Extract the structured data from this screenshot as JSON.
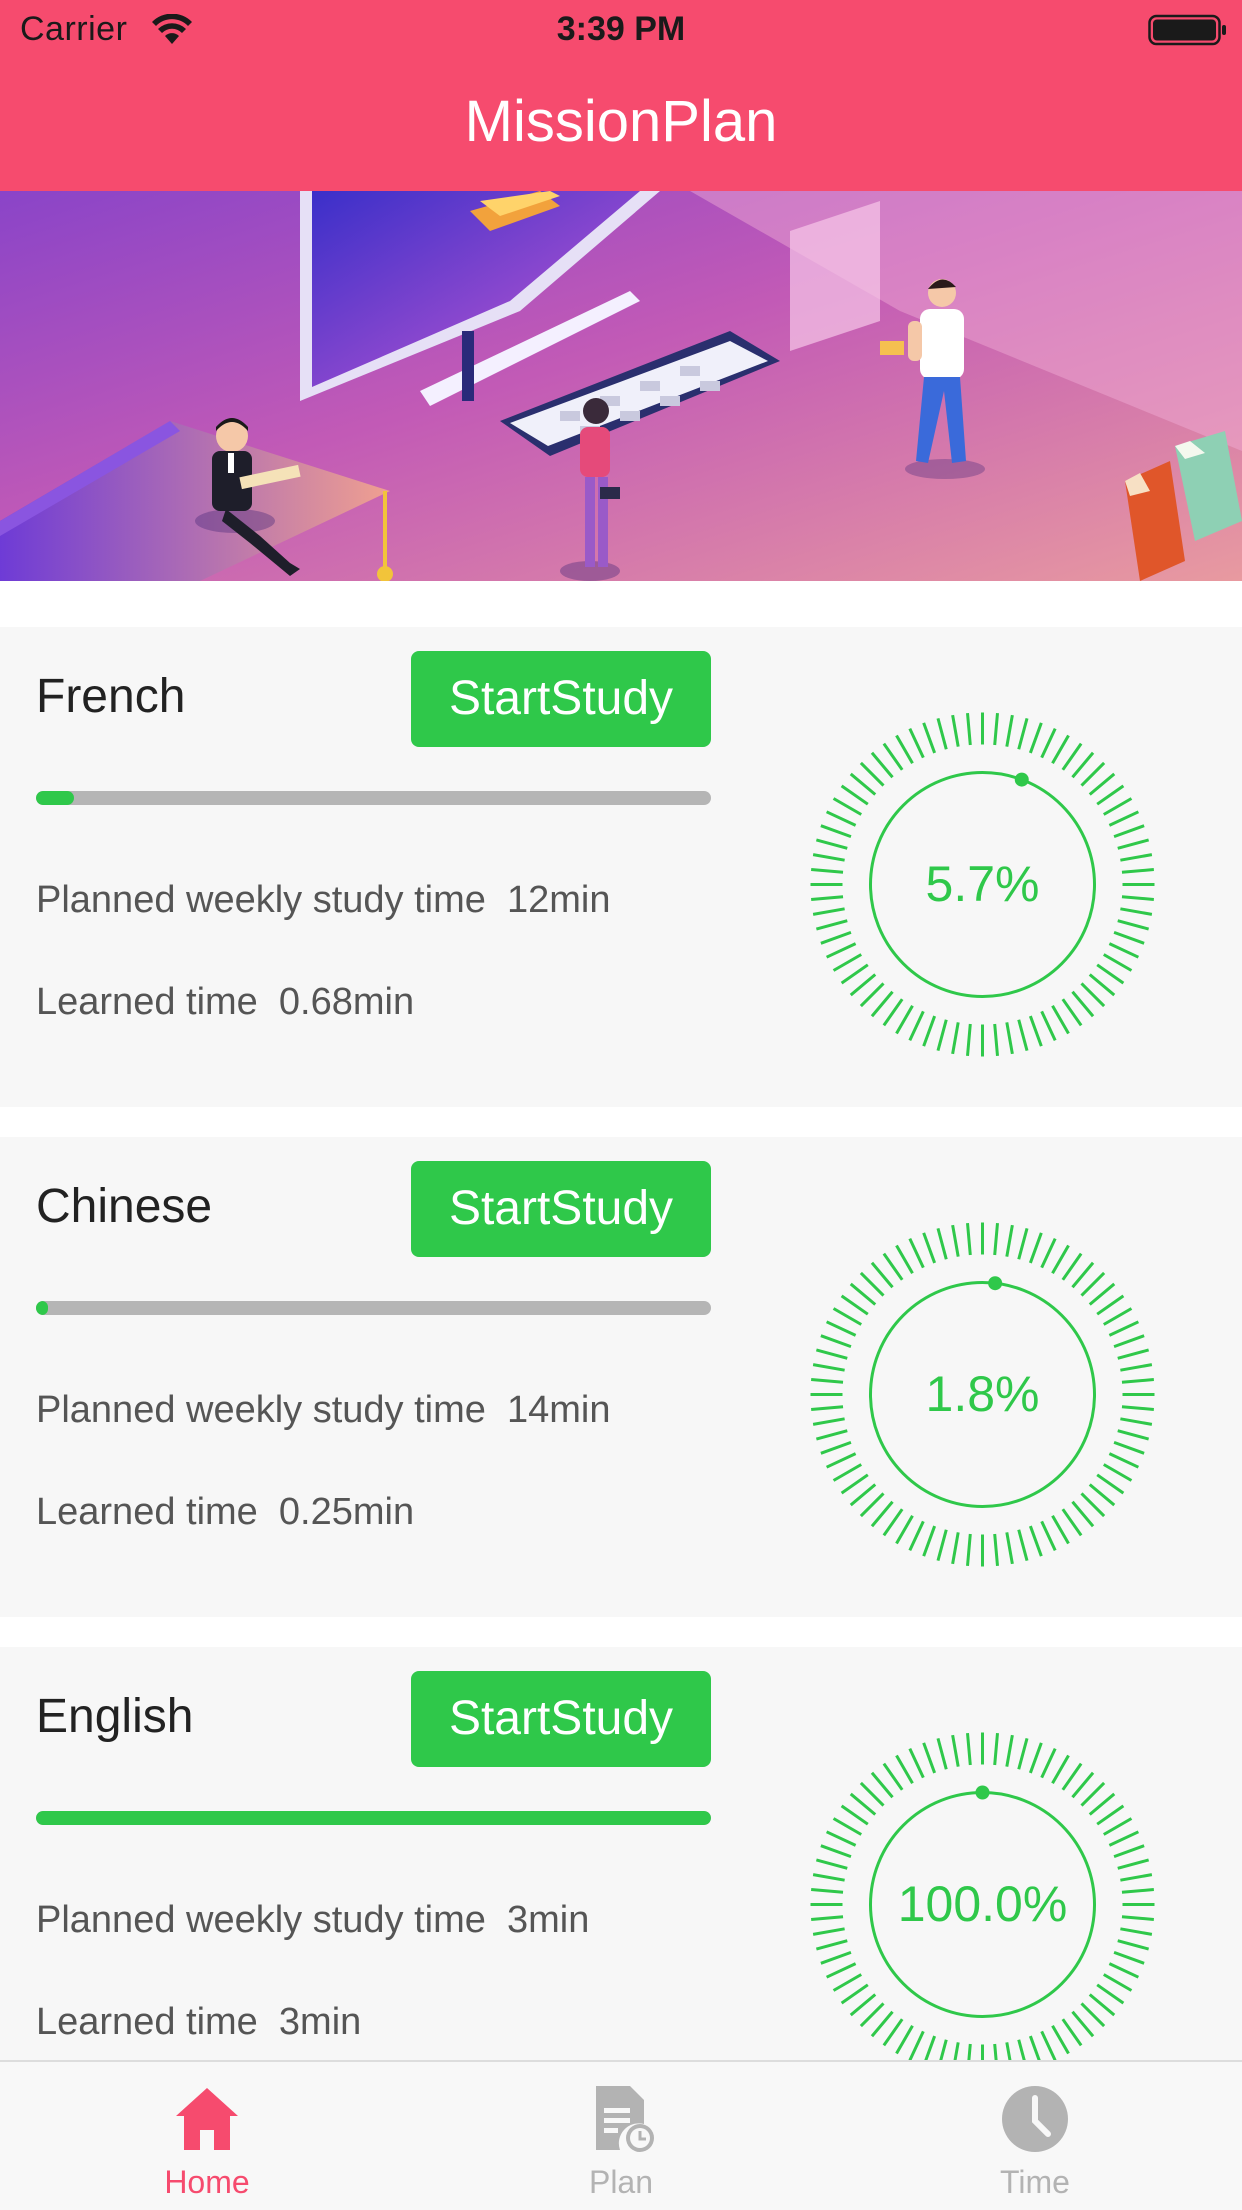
{
  "status_bar": {
    "carrier": "Carrier",
    "time": "3:39 PM"
  },
  "nav": {
    "title": "MissionPlan"
  },
  "colors": {
    "header": "#F64B6E",
    "accent_green": "#2FC84A",
    "tab_active": "#F64B6E",
    "tab_inactive": "#B3B3B3"
  },
  "cards": [
    {
      "title": "French",
      "button_label": "StartStudy",
      "progress": 0.057,
      "planned": "Planned weekly study time  12min",
      "learned": "Learned time  0.68min",
      "percent_label": "5.7%"
    },
    {
      "title": "Chinese",
      "button_label": "StartStudy",
      "progress": 0.018,
      "planned": "Planned weekly study time  14min",
      "learned": "Learned time  0.25min",
      "percent_label": "1.8%"
    },
    {
      "title": "English",
      "button_label": "StartStudy",
      "progress": 1.0,
      "planned": "Planned weekly study time  3min",
      "learned": "Learned time  3min",
      "percent_label": "100.0%"
    }
  ],
  "tabbar": {
    "items": [
      {
        "label": "Home",
        "icon": "house-icon",
        "active": true
      },
      {
        "label": "Plan",
        "icon": "document-clock-icon",
        "active": false
      },
      {
        "label": "Time",
        "icon": "clock-icon",
        "active": false
      }
    ]
  }
}
